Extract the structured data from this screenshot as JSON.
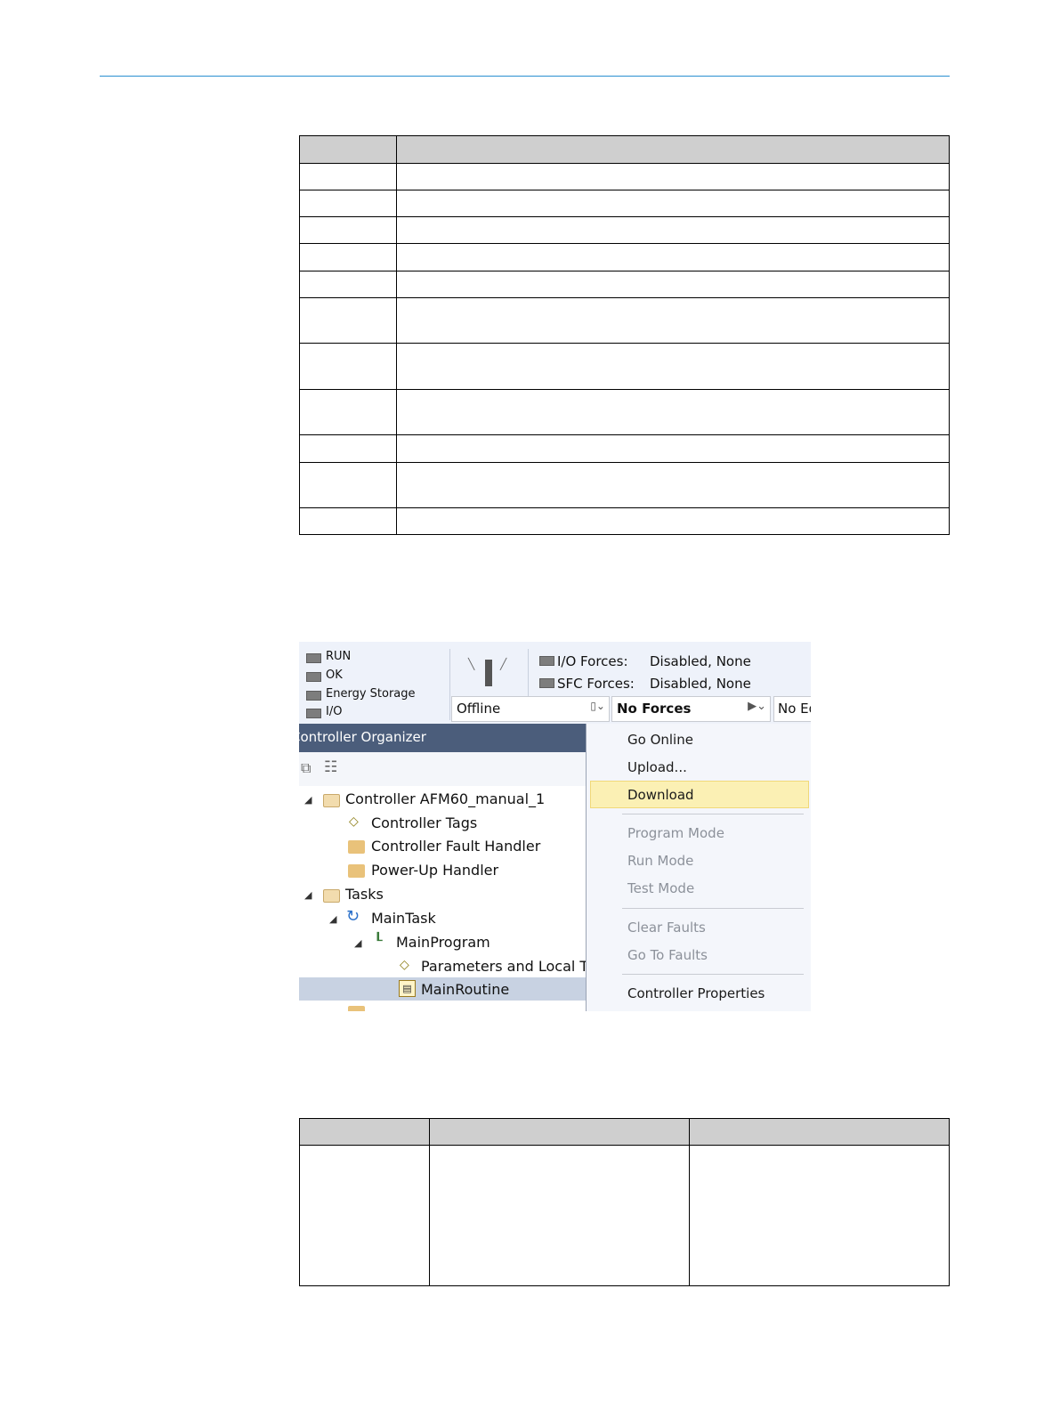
{
  "screenshot": {
    "status": {
      "leds": [
        "RUN",
        "OK",
        "Energy Storage",
        "I/O"
      ],
      "io_forces_label": "I/O Forces:",
      "io_forces_value": "Disabled, None",
      "sfc_forces_label": "SFC Forces:",
      "sfc_forces_value": "Disabled, None",
      "mode": "Offline",
      "forces": "No Forces",
      "edits": "No Ed"
    },
    "organizer": {
      "title": "Controller Organizer",
      "tree": [
        "Controller AFM60_manual_1",
        "Controller Tags",
        "Controller Fault Handler",
        "Power-Up Handler",
        "Tasks",
        "MainTask",
        "MainProgram",
        "Parameters and Local Ta",
        "MainRoutine"
      ]
    },
    "menu": {
      "items": [
        "Go Online",
        "Upload...",
        "Download",
        "Program Mode",
        "Run Mode",
        "Test Mode",
        "Clear Faults",
        "Go To Faults",
        "Controller Properties"
      ]
    }
  }
}
